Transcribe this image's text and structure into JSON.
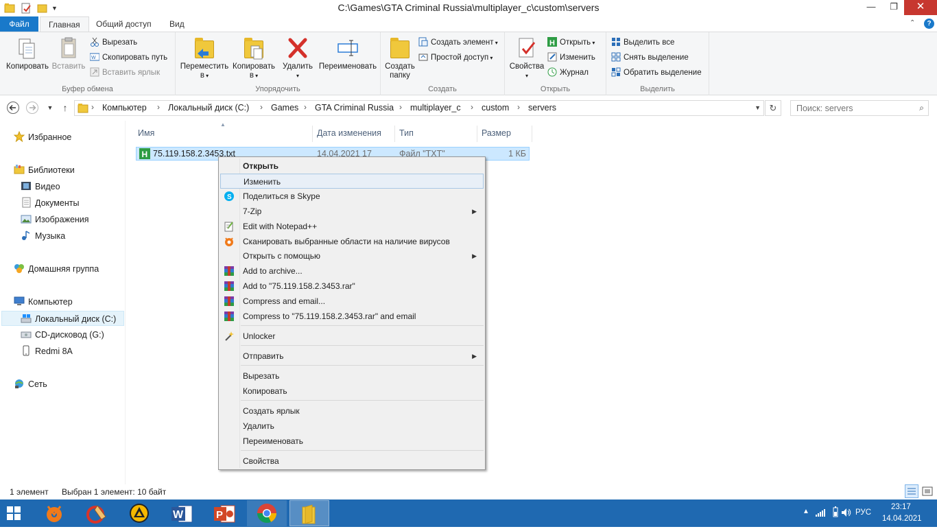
{
  "window": {
    "title": "C:\\Games\\GTA Criminal Russia\\multiplayer_c\\custom\\servers",
    "minimize": "—",
    "maximize": "❐",
    "close": "✕"
  },
  "ribbon_tabs": [
    "Файл",
    "Главная",
    "Общий доступ",
    "Вид"
  ],
  "ribbon": {
    "clipboard": {
      "label": "Буфер обмена",
      "copy": "Копировать",
      "paste": "Вставить",
      "cut": "Вырезать",
      "copy_path": "Скопировать путь",
      "paste_shortcut": "Вставить ярлык"
    },
    "organize": {
      "label": "Упорядочить",
      "move_to": "Переместить",
      "copy_to": "Копировать",
      "to_suffix": "в",
      "delete": "Удалить",
      "rename": "Переименовать"
    },
    "new": {
      "label": "Создать",
      "new_folder_1": "Создать",
      "new_folder_2": "папку",
      "new_item": "Создать элемент",
      "easy_access": "Простой доступ"
    },
    "open": {
      "label": "Открыть",
      "properties": "Свойства",
      "open": "Открыть",
      "edit": "Изменить",
      "history": "Журнал"
    },
    "select": {
      "label": "Выделить",
      "select_all": "Выделить все",
      "select_none": "Снять выделение",
      "invert": "Обратить выделение"
    }
  },
  "address": {
    "crumbs": [
      "Компьютер",
      "Локальный диск (C:)",
      "Games",
      "GTA Criminal Russia",
      "multiplayer_c",
      "custom",
      "servers"
    ],
    "search_placeholder": "Поиск: servers"
  },
  "nav": {
    "favorites": "Избранное",
    "libraries": "Библиотеки",
    "video": "Видео",
    "documents": "Документы",
    "images": "Изображения",
    "music": "Музыка",
    "homegroup": "Домашняя группа",
    "computer": "Компьютер",
    "local_disk": "Локальный диск (C:)",
    "cd_drive": "CD-дисковод (G:)",
    "phone": "Redmi 8A",
    "network": "Сеть"
  },
  "columns": [
    "Имя",
    "Дата изменения",
    "Тип",
    "Размер"
  ],
  "file": {
    "name": "75.119.158.2.3453.txt",
    "date": "14.04.2021 17",
    "type": "Файл \"TXT\"",
    "size": "1 КБ"
  },
  "context_menu": {
    "open": "Открыть",
    "edit": "Изменить",
    "skype": "Поделиться в Skype",
    "zip": "7-Zip",
    "notepadpp": "Edit with Notepad++",
    "avast": "Сканировать выбранные области на наличие вирусов",
    "open_with": "Открыть с помощью",
    "add_archive": "Add to archive...",
    "add_rar": "Add to \"75.119.158.2.3453.rar\"",
    "compress_email": "Compress and email...",
    "compress_rar_email": "Compress to \"75.119.158.2.3453.rar\" and email",
    "unlocker": "Unlocker",
    "send_to": "Отправить",
    "cut": "Вырезать",
    "copy": "Копировать",
    "create_shortcut": "Создать ярлык",
    "delete": "Удалить",
    "rename": "Переименовать",
    "properties": "Свойства"
  },
  "status": {
    "count": "1 элемент",
    "selected": "Выбран 1 элемент: 10 байт"
  },
  "taskbar": {
    "lang": "РУС",
    "time": "23:17",
    "date": "14.04.2021"
  },
  "colors": {
    "accent": "#1979ca",
    "taskbar": "#1f69b1",
    "selection": "#cce8ff"
  }
}
